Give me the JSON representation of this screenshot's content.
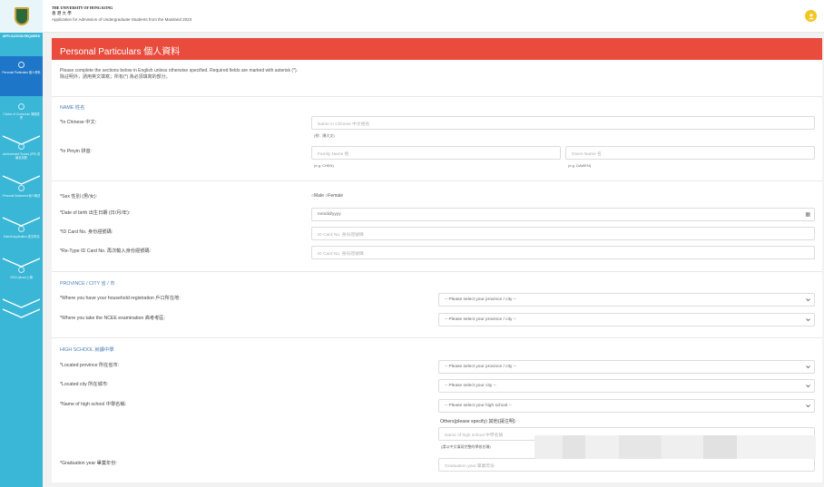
{
  "header": {
    "university_en": "THE UNIVERSITY OF HONG KONG",
    "university_cn": "香 港 大 學",
    "app_title": "Application for Admission of Undergraduate Students from the Mainland 2023"
  },
  "sidebar": {
    "title": "APPLICATION REQUIRED",
    "steps": [
      {
        "label": "Personal Particulars 個人資料",
        "active": true
      },
      {
        "label": "Choice of Curriculum 課程選擇",
        "active": false
      },
      {
        "label": "Achievement Scores (IPE) 成績及資歷",
        "active": false
      },
      {
        "label": "Personal Statement 個人陳述",
        "active": false
      },
      {
        "label": "Submit Application 遞交申請",
        "active": false
      },
      {
        "label": "GPA Upload 上傳",
        "active": false
      }
    ]
  },
  "page": {
    "banner": "Personal Particulars 個人資料",
    "intro_en": "Please complete the sections below in English unless otherwise specified. Required fields are marked with asterisk (*).",
    "intro_cn": "除註明外，請用英文填寫；所有(*) 為必須填寫的部分。"
  },
  "name_section": {
    "title": "NAME 姓名",
    "chinese_label": "*In Chinese 中文:",
    "chinese_placeholder": "Name in Chinese 中文姓名",
    "chinese_hint": "(例：陳大文)",
    "pinyin_label": "*In Pinyin 拼音:",
    "family_placeholder": "Family Name 姓",
    "family_hint": "(e.g. CHEN)",
    "given_placeholder": "Given Name 名",
    "given_hint": "(e.g. DAWEN)"
  },
  "personal": {
    "sex_label": "*Sex 性別 (男/女):",
    "male": "Male",
    "female": "Female",
    "dob_label": "*Date of birth 出生日期 (日/月/年):",
    "dob_value": "mm/dd/yyyy",
    "id_label": "*ID Card No. 身份證號碼:",
    "id_placeholder": "ID Card No. 身份證號碼",
    "reid_label": "*Re-Type ID Card No. 再次輸入身份證號碼:",
    "reid_placeholder": "ID Card No. 身份證號碼"
  },
  "province_section": {
    "title": "PROVINCE / CITY 省 / 市",
    "household_label": "*Where you have your household registration 戶口所在地:",
    "household_value": "-- Please select your province / city --",
    "ncee_label": "*Where you take the NCEE examination 高考考區:",
    "ncee_value": "-- Please select your province / city --"
  },
  "school_section": {
    "title": "HIGH SCHOOL 就讀中學",
    "province_label": "*Located province 所在省市:",
    "province_value": "-- Please select your province / city --",
    "city_label": "*Located city 所在城市:",
    "city_value": "-- Please select your city --",
    "school_label": "*Name of high school 中學名稱:",
    "school_value": "-- Please select your high school --",
    "others_label": "Others(please specify) 其他(請注明)",
    "others_placeholder": "Name of high school 中學名稱",
    "others_hint": "(請以中文填寫完整的學校名稱)",
    "grad_label": "*Graduation year 畢業年份:",
    "grad_placeholder": "Graduation year 畢業年份"
  }
}
